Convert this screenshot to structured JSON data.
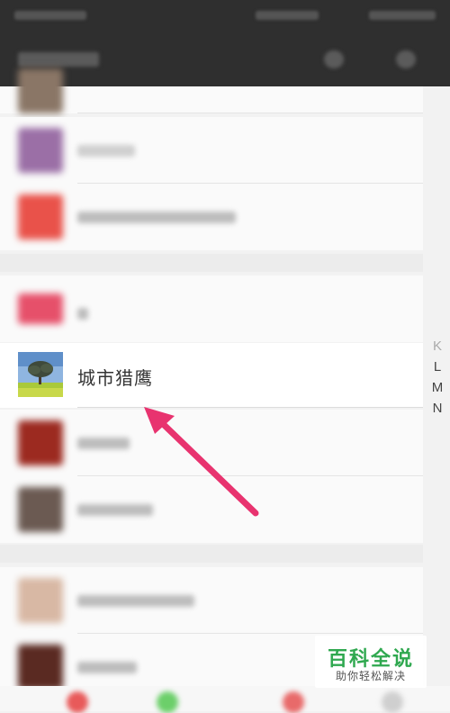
{
  "contact": {
    "name": "城市猎鹰"
  },
  "index_letters": [
    "K",
    "L",
    "M",
    "N"
  ],
  "watermark": {
    "brand": "百科全说",
    "slogan": "助你轻松解决"
  },
  "colors": {
    "header": "#2f2f2f",
    "arrow": "#e8336f",
    "brand_green": "#2fa84f"
  },
  "icons": {
    "arrow": "arrow-pointer-icon",
    "avatar": "tree-avatar-icon"
  }
}
